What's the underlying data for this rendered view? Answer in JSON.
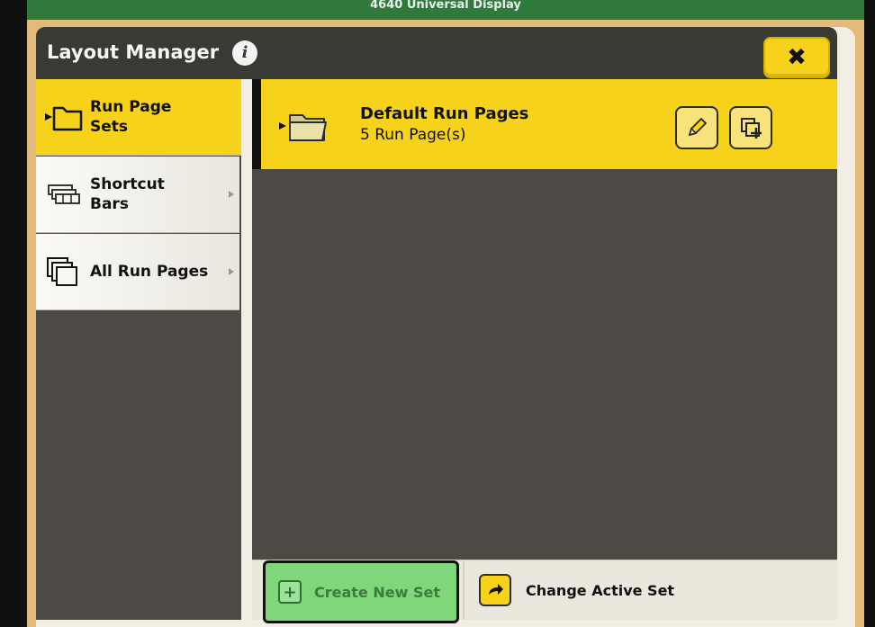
{
  "app_bar": {
    "title": "4640 Universal Display"
  },
  "dialog": {
    "title": "Layout Manager",
    "close_label": "✖"
  },
  "sidebar": {
    "items": [
      {
        "label_line1": "Run Page",
        "label_line2": "Sets",
        "icon": "folder-icon",
        "active": true
      },
      {
        "label_line1": "Shortcut",
        "label_line2": "Bars",
        "icon": "shortcut-bars-icon",
        "active": false
      },
      {
        "label_line1": "All Run Pages",
        "label_line2": "",
        "icon": "pages-stack-icon",
        "active": false
      }
    ]
  },
  "content": {
    "rows": [
      {
        "name": "Default Run Pages",
        "sub": "5 Run Page(s)",
        "active": true
      }
    ]
  },
  "bottom_bar": {
    "create_label": "Create New Set",
    "change_label": "Change Active Set"
  },
  "colors": {
    "accent_yellow": "#f7d21b",
    "panel_dark": "#4d4a45",
    "create_green": "#7fd77a",
    "top_green": "#2f7a3a"
  }
}
